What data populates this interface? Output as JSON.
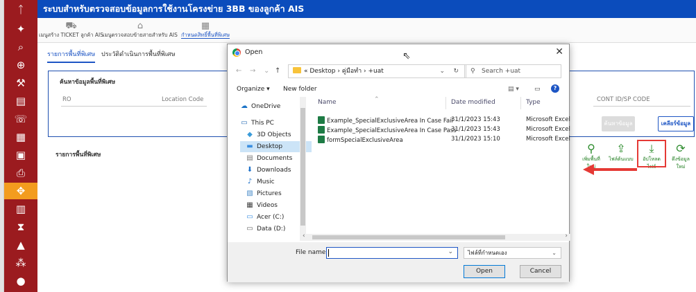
{
  "app": {
    "title": "ระบบสำหรับตรวจสอบข้อมูลการใช้งานโครงข่าย 3BB ของลูกค้า AIS"
  },
  "menu": {
    "items": [
      {
        "label": "เมนูสร้าง TICKET ลูกค้า AIS",
        "icon": "ticket-icon"
      },
      {
        "label": "เมนูตรวจสอบข้ายสายสำหรับ AIS",
        "icon": "home-icon"
      },
      {
        "label": "กำหนดสิทธิ์พื้นที่พิเศษ",
        "icon": "area-icon",
        "active": true
      }
    ]
  },
  "tabs": {
    "items": [
      {
        "label": "รายการพื้นที่พิเศษ",
        "active": true
      },
      {
        "label": "ประวัติดำเนินการพื้นที่พิเศษ",
        "active": false
      }
    ]
  },
  "search_panel": {
    "title": "ค้นหาข้อมูลพื้นที่พิเศษ",
    "fields": {
      "ro": "RO",
      "location_code": "Location Code",
      "cont_id": "CONT ID/SP CODE"
    },
    "search_button": "ค้นหาข้อมูล",
    "clear_button": "เคลียร์ข้อมูล"
  },
  "list": {
    "title": "รายการพื้นที่พิเศษ",
    "actions": [
      {
        "label": "เพิ่มพื้นที่ใหม่",
        "icon": "add-location-icon"
      },
      {
        "label": "ไฟล์ต้นแบบ",
        "icon": "download-icon"
      },
      {
        "label": "อัปโหลดไฟล์",
        "icon": "upload-icon"
      },
      {
        "label": "ดึงข้อมูลใหม่",
        "icon": "refresh-icon"
      }
    ]
  },
  "dialog": {
    "title": "Open",
    "path": "« Desktop  ›  คู่มือทำ  ›  +uat",
    "search_placeholder": "Search +uat",
    "organize": "Organize ▾",
    "new_folder": "New folder",
    "nav_items": [
      {
        "label": "OneDrive",
        "icon": "cloud-icon"
      },
      {
        "label": "This PC",
        "icon": "computer-icon"
      },
      {
        "label": "3D Objects",
        "icon": "cube-icon"
      },
      {
        "label": "Desktop",
        "icon": "desktop-icon",
        "selected": true
      },
      {
        "label": "Documents",
        "icon": "document-icon"
      },
      {
        "label": "Downloads",
        "icon": "download-icon"
      },
      {
        "label": "Music",
        "icon": "music-icon"
      },
      {
        "label": "Pictures",
        "icon": "picture-icon"
      },
      {
        "label": "Videos",
        "icon": "video-icon"
      },
      {
        "label": "Acer (C:)",
        "icon": "drive-icon"
      },
      {
        "label": "Data (D:)",
        "icon": "drive-icon"
      }
    ],
    "columns": {
      "name": "Name",
      "date": "Date modified",
      "type": "Type"
    },
    "files": [
      {
        "name": "Example_SpecialExclusiveArea In Case Fail",
        "date": "31/1/2023 15:43",
        "type": "Microsoft Excel"
      },
      {
        "name": "Example_SpecialExclusiveArea In Case Pass",
        "date": "31/1/2023 15:43",
        "type": "Microsoft Excel"
      },
      {
        "name": "formSpecialExclusiveArea",
        "date": "31/1/2023 15:10",
        "type": "Microsoft Excel"
      }
    ],
    "file_name_label": "File name:",
    "file_name_value": "",
    "file_type": "ไฟล์ที่กำหนดเอง",
    "open_button": "Open",
    "cancel_button": "Cancel"
  },
  "colors": {
    "sidebar": "#9b1b1f",
    "sidebar_active": "#f39c1e",
    "topbar": "#0b4cbc",
    "accent": "#1d55c4",
    "action_green": "#2d8c2d",
    "highlight_red": "#e53935"
  }
}
